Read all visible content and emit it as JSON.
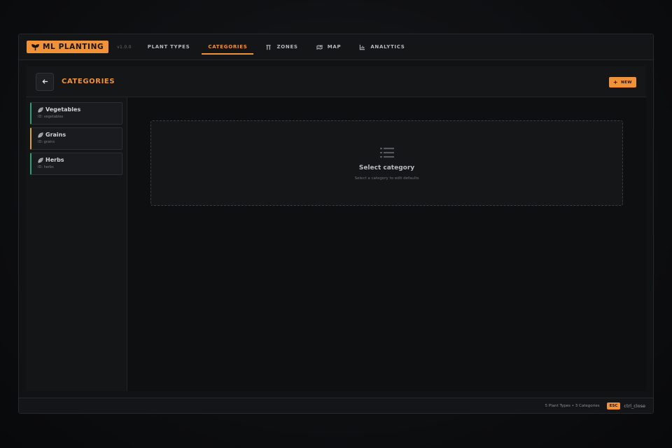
{
  "app": {
    "logo_text": "ML PLANTING",
    "version": "v1.0.0",
    "colors": {
      "accent": "#f0923a",
      "green": "#2fa06e",
      "amber": "#e0a23a"
    }
  },
  "nav": {
    "items": [
      {
        "label": "PLANT TYPES",
        "icon": "none"
      },
      {
        "label": "CATEGORIES",
        "icon": "none",
        "active": true
      },
      {
        "label": "ZONES",
        "icon": "zone-icon"
      },
      {
        "label": "MAP",
        "icon": "map-icon"
      },
      {
        "label": "ANALYTICS",
        "icon": "chart-icon"
      }
    ]
  },
  "header": {
    "title": "CATEGORIES",
    "new_label": "NEW"
  },
  "categories": [
    {
      "name": "Vegetables",
      "id": "ID: vegetables",
      "color": "#2fa06e"
    },
    {
      "name": "Grains",
      "id": "ID: grains",
      "color": "#e0a23a"
    },
    {
      "name": "Herbs",
      "id": "ID: herbs",
      "color": "#2fa06e"
    }
  ],
  "empty_state": {
    "title": "Select category",
    "subtitle": "Select a category to edit defaults",
    "icon": "list-icon"
  },
  "footer": {
    "info": "5 Plant Types • 3 Categories",
    "key": "ESC",
    "key_label": "ctrl_close"
  }
}
